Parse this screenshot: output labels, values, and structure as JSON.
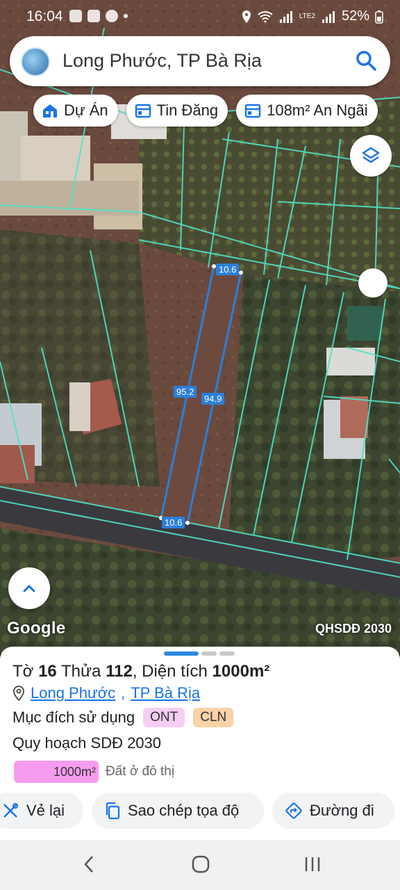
{
  "status_bar": {
    "time": "16:04",
    "battery": "52%",
    "network_label": "LTE2"
  },
  "search": {
    "query": "Long Phước, TP Bà Rịa"
  },
  "chips": [
    {
      "icon": "building-icon",
      "label": "Dự Án"
    },
    {
      "icon": "listing-icon",
      "label": "Tin Đăng"
    },
    {
      "icon": "listing-icon",
      "label": "108m² An Ngãi"
    }
  ],
  "map": {
    "labels": {
      "top_edge": "10.6",
      "bottom_edge": "10.6",
      "left_edge": "95.2",
      "right_edge": "94.9"
    },
    "attribution": "Google",
    "overlay": "QHSDĐ 2030"
  },
  "parcel": {
    "to_prefix": "Tờ",
    "to_number": "16",
    "thua_prefix": "Thửa",
    "thua_number": "112",
    "area_prefix": ", Diện tích",
    "area_value": "1000m²",
    "commune": "Long Phước",
    "city": "TP Bà Rịa",
    "purpose_label": "Mục đích sử dụng",
    "purpose_codes": [
      "ONT",
      "CLN"
    ],
    "plan_label": "Quy hoạch SDĐ 2030",
    "legend_area": "1000m²",
    "legend_desc": "Đất ở đô thị"
  },
  "actions": {
    "redraw": "Vẻ lại",
    "copy_coords": "Sao chép tọa độ",
    "directions": "Đường đi"
  },
  "colors": {
    "accent": "#1a73e8",
    "parcel_line": "#2c7fd8",
    "cadastral_line": "#4fe3c9",
    "ont": "#f6cdf4",
    "cln": "#f9d2a8"
  }
}
